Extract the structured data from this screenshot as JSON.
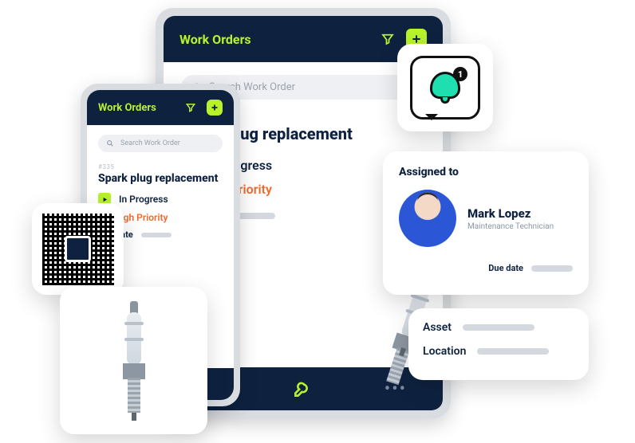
{
  "colors": {
    "background": "#ffffff",
    "navy": "#0e2240",
    "lime": "#b7f22b",
    "orange": "#f26a2a",
    "teal": "#1fdfb0"
  },
  "header": {
    "title": "Work Orders"
  },
  "search": {
    "placeholder": "Search Work Order"
  },
  "workorder": {
    "id": "#335",
    "title": "Spark plug replacement",
    "status": "In Progress",
    "priority": "High Priority",
    "due_label": "Due date"
  },
  "assigned": {
    "heading": "Assigned to",
    "name": "Mark Lopez",
    "role": "Maintenance Technician",
    "due_label": "Due date"
  },
  "details": {
    "asset_label": "Asset",
    "location_label": "Location"
  },
  "notification_badge": "1",
  "tablet_tabs": {
    "journal_icon": "tab-journal",
    "wrench_icon": "tab-wrench",
    "more_icon": "tab-more"
  }
}
